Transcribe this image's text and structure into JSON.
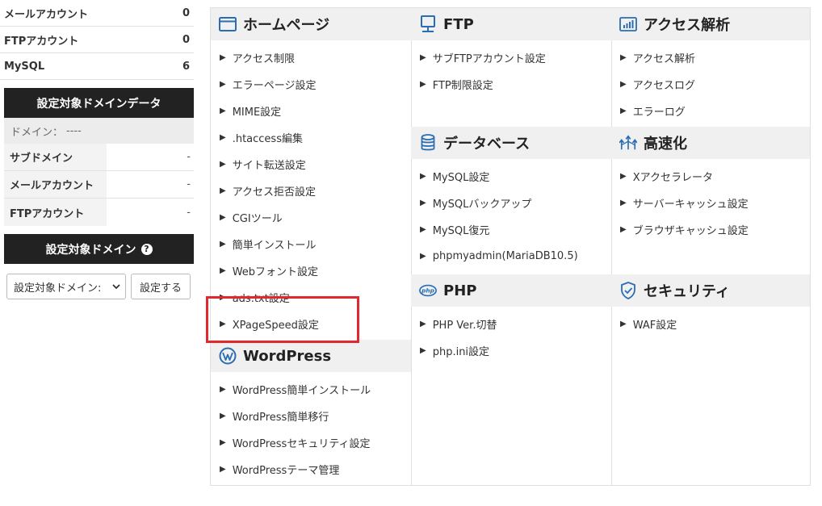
{
  "account_counts": [
    {
      "label": "メールアカウント",
      "value": "0"
    },
    {
      "label": "FTPアカウント",
      "value": "0"
    },
    {
      "label": "MySQL",
      "value": "6"
    }
  ],
  "domain_data": {
    "header": "設定対象ドメインデータ",
    "domain_label": "ドメイン：",
    "domain_value": "----",
    "rows": [
      {
        "label": "サブドメイン",
        "value": "-"
      },
      {
        "label": "メールアカウント",
        "value": "-"
      },
      {
        "label": "FTPアカウント",
        "value": "-"
      }
    ]
  },
  "target_domain": {
    "header": "設定対象ドメイン",
    "help_glyph": "?",
    "select_value": "設定対象ドメイン:",
    "submit_label": "設定する"
  },
  "sections": {
    "homepage": {
      "title": "ホームページ",
      "icon": "browser-window-icon",
      "links": [
        "アクセス制限",
        "エラーページ設定",
        "MIME設定",
        ".htaccess編集",
        "サイト転送設定",
        "アクセス拒否設定",
        "CGIツール",
        "簡単インストール",
        "Webフォント設定",
        "ads.txt設定",
        "XPageSpeed設定"
      ]
    },
    "wordpress": {
      "title": "WordPress",
      "icon": "wordpress-icon",
      "links": [
        "WordPress簡単インストール",
        "WordPress簡単移行",
        "WordPressセキュリティ設定",
        "WordPressテーマ管理"
      ]
    },
    "ftp": {
      "title": "FTP",
      "icon": "monitor-icon",
      "links": [
        "サブFTPアカウント設定",
        "FTP制限設定"
      ]
    },
    "database": {
      "title": "データベース",
      "icon": "database-icon",
      "links": [
        "MySQL設定",
        "MySQLバックアップ",
        "MySQL復元",
        "phpmyadmin(MariaDB10.5)"
      ]
    },
    "php": {
      "title": "PHP",
      "icon": "php-icon",
      "icon_text": "php",
      "links": [
        "PHP Ver.切替",
        "php.ini設定"
      ]
    },
    "access": {
      "title": "アクセス解析",
      "icon": "bar-chart-icon",
      "links": [
        "アクセス解析",
        "アクセスログ",
        "エラーログ"
      ]
    },
    "speed": {
      "title": "高速化",
      "icon": "speed-arrows-icon",
      "links": [
        "Xアクセラレータ",
        "サーバーキャッシュ設定",
        "ブラウザキャッシュ設定"
      ]
    },
    "security": {
      "title": "セキュリティ",
      "icon": "shield-check-icon",
      "links": [
        "WAF設定"
      ]
    }
  },
  "highlight_color": "#e0282e",
  "link_arrow": "▶"
}
